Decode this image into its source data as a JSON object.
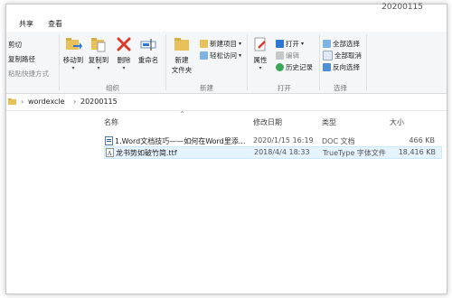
{
  "window": {
    "title": "20200115"
  },
  "tabs": [
    {
      "label": "共享"
    },
    {
      "label": "查看"
    }
  ],
  "ribbon": {
    "clipboard": {
      "cut": "剪切",
      "copy_path": "复制路径",
      "paste_shortcut": "粘贴快捷方式"
    },
    "organize": {
      "label": "组织",
      "move_to": "移动到",
      "copy_to": "复制到",
      "delete": "删除",
      "rename": "重命名"
    },
    "new": {
      "label": "新建",
      "new_folder_line1": "新建",
      "new_folder_line2": "文件夹",
      "new_item": "新建项目",
      "easy_access": "轻松访问"
    },
    "open": {
      "label": "打开",
      "properties": "属性",
      "open": "打开",
      "edit": "编辑",
      "history": "历史记录"
    },
    "select": {
      "label": "选择",
      "select_all": "全部选择",
      "select_none": "全部取消",
      "invert": "反向选择"
    }
  },
  "address": {
    "crumbs": [
      "wordexcle",
      "20200115"
    ]
  },
  "columns": {
    "name": "名称",
    "modified": "修改日期",
    "type": "类型",
    "size": "大小"
  },
  "files": [
    {
      "name": "1.Word文档技巧——如何在Word里添...",
      "modified": "2020/1/15 16:19",
      "type": "DOC 文档",
      "size": "466 KB",
      "icon": "word-doc-icon"
    },
    {
      "name": "龙书势如破竹简.ttf",
      "modified": "2018/4/4 18:33",
      "type": "TrueType 字体文件",
      "size": "18,416 KB",
      "icon": "font-file-icon"
    }
  ],
  "colors": {
    "ribbon_bg": "#f5f6f7",
    "selection": "#e5f3ff",
    "folder": "#e8c15a"
  }
}
